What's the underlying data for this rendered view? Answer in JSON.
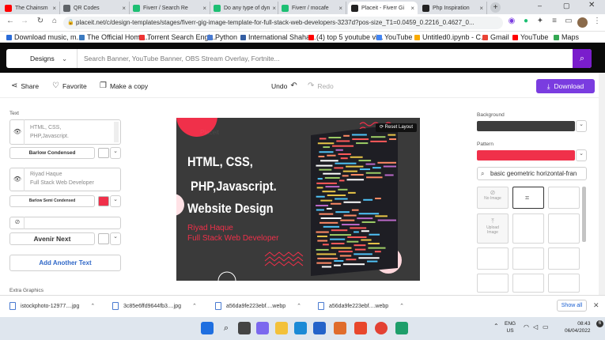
{
  "browser": {
    "tabs": [
      {
        "title": "The Chainsm",
        "color": "#ff0000"
      },
      {
        "title": "QR Codes",
        "color": "#5f6368"
      },
      {
        "title": "Fiverr / Search Re",
        "color": "#1dbf73"
      },
      {
        "title": "Do any type of dyn",
        "color": "#1dbf73"
      },
      {
        "title": "Fiverr / mocafe",
        "color": "#1dbf73"
      },
      {
        "title": "Placeit - Fiverr Gi",
        "color": "#222222",
        "active": true
      },
      {
        "title": "Php Inspiration",
        "color": "#222222"
      }
    ],
    "url": "placeit.net/c/design-templates/stages/fiverr-gig-image-template-for-full-stack-web-developers-3237d?pos-size_T1=0.0459_0.2216_0.4627_0...",
    "bookmarks": [
      "Download music, m...",
      "The Official Home...",
      "Torrent Search Engi...",
      "Python",
      "International Shaha...",
      "(4) top 5 youtube vi...",
      "YouTube",
      "Untitled0.ipynb - C...",
      "Gmail",
      "YouTube",
      "Maps"
    ]
  },
  "header": {
    "designs_label": "Designs",
    "search_placeholder": "Search Banner, YouTube Banner, OBS Stream Overlay, Fortnite..."
  },
  "toolbar": {
    "share": "Share",
    "favorite": "Favorite",
    "make_copy": "Make a copy",
    "undo": "Undo",
    "redo": "Redo",
    "download": "Download"
  },
  "left_panel": {
    "text_label": "Text",
    "field1": "HTML, CSS, PHP,Javascript.",
    "font1": "Barlow Condensed",
    "field2_line1": "Riyad Haque",
    "field2_line2": "Full Stack Web Developer",
    "font2": "Barlow Semi Condensed",
    "font3": "Avenir Next",
    "add_text": "Add Another Text",
    "extra_graphics": "Extra Graphics",
    "color2": "#f0304a"
  },
  "canvas": {
    "headline1": "HTML, CSS,",
    "headline2": "PHP,Javascript.",
    "headline3": "Website Design",
    "name": "Riyad Haque",
    "role": "Full Stack Web Developer",
    "reset": "Reset Layout",
    "watermark": "Placeit",
    "accent": "#f0304a",
    "bg": "#3a3a3a"
  },
  "right_panel": {
    "background_label": "Background",
    "background_color": "#3c3c3c",
    "pattern_label": "Pattern",
    "pattern_color": "#f0304a",
    "pattern_search": "basic geometric horizontal-fran",
    "no_image": "No Image",
    "upload_image": "Upload Image"
  },
  "downloads": {
    "items": [
      "istockphoto-12977....jpg",
      "3c85e6ffd9644fb3....jpg",
      "a56da9fe223ebf....webp",
      "a56da9fe223ebf....webp"
    ],
    "show_all": "Show all"
  },
  "taskbar": {
    "lang1": "ENG",
    "lang2": "US",
    "time": "08:43",
    "date": "06/04/2022"
  }
}
